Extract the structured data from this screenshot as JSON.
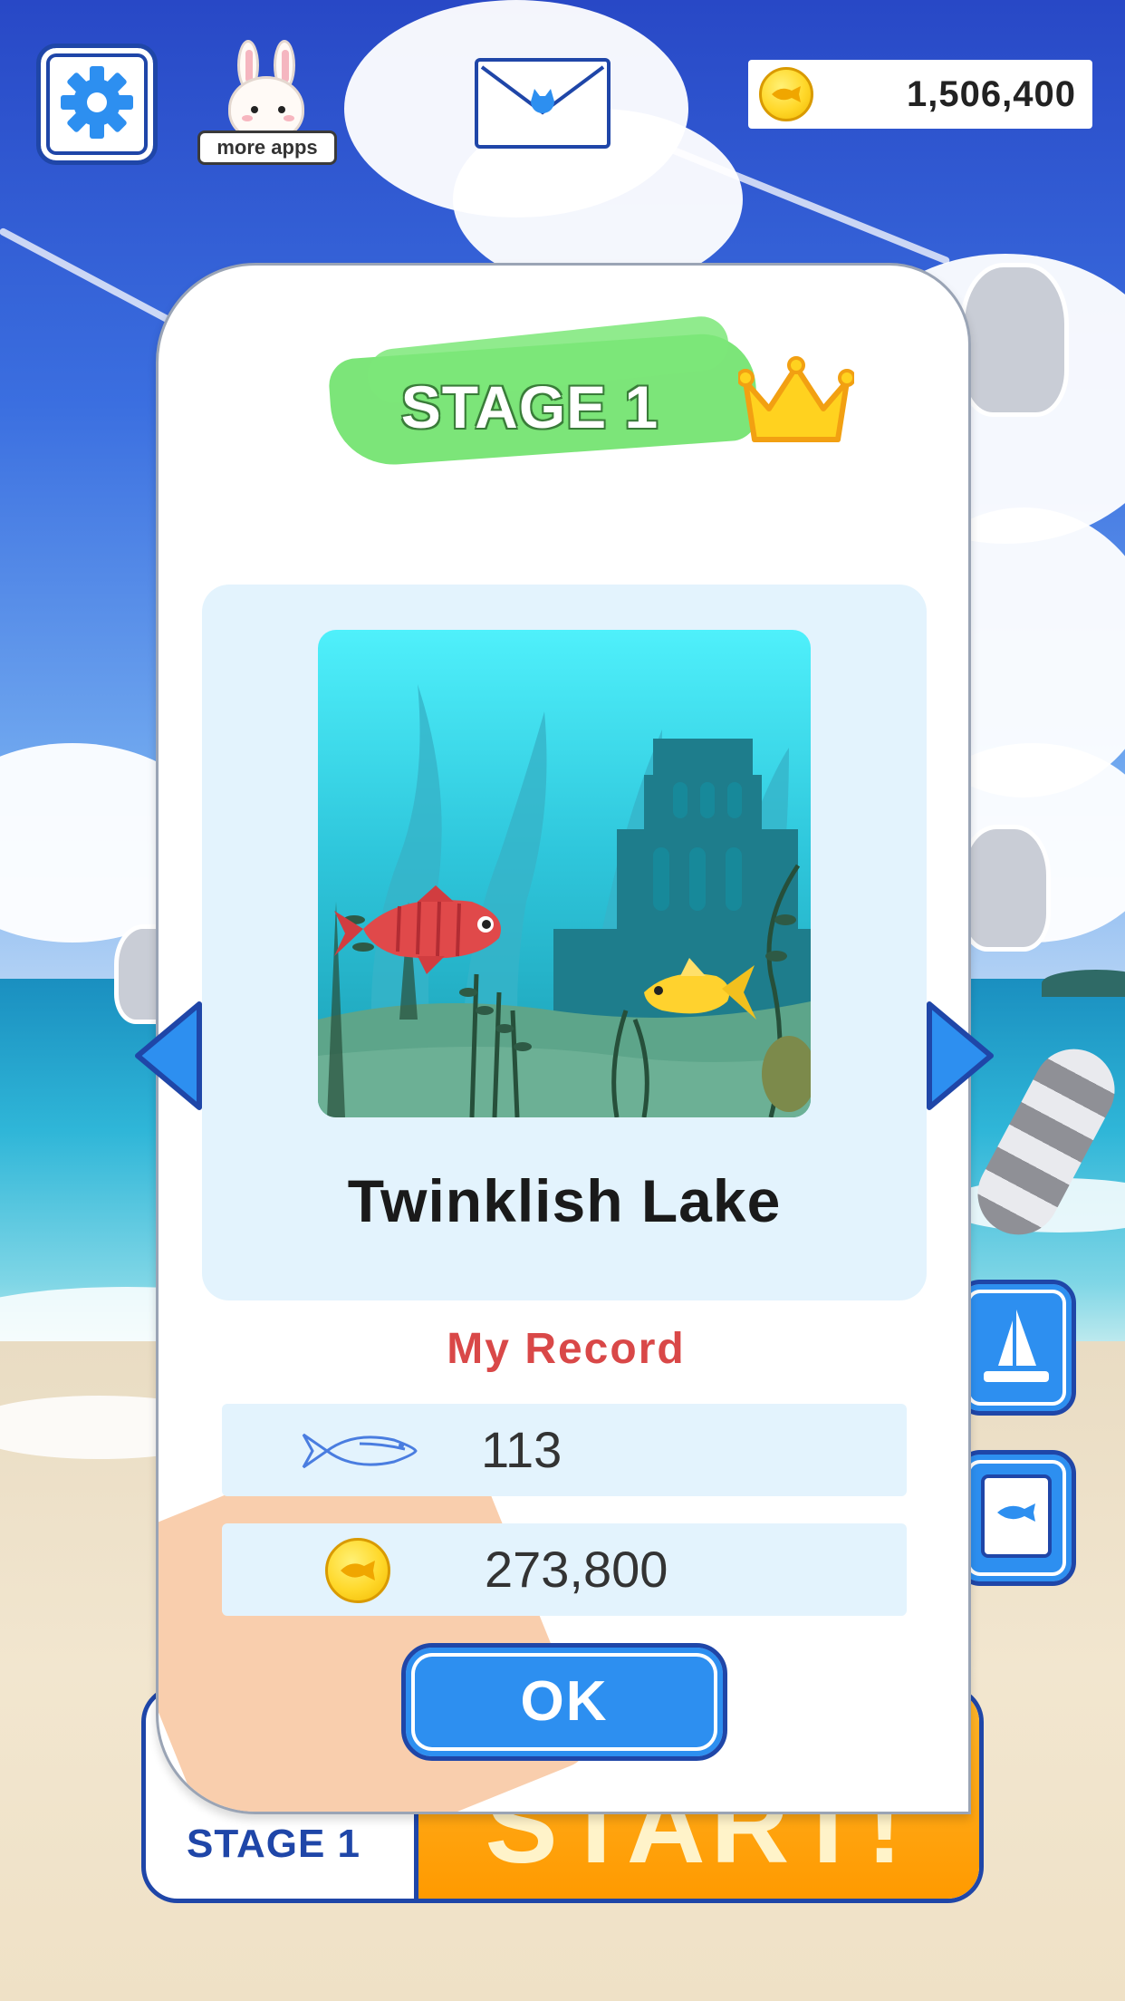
{
  "header": {
    "more_apps_label": "more apps",
    "coin_balance": "1,506,400"
  },
  "stage_panel": {
    "title": "STAGE 1",
    "stage_name": "Twinklish Lake",
    "record_title": "My Record",
    "records": [
      {
        "icon": "fish-outline-icon",
        "value": "113"
      },
      {
        "icon": "coin-icon",
        "value": "273,800"
      }
    ],
    "ok_label": "OK"
  },
  "bottom": {
    "stage_label": "STAGE 1",
    "start_label": "START!"
  },
  "colors": {
    "accent_blue": "#2d8ff0",
    "border_navy": "#1f46a8",
    "record_red": "#d94848",
    "start_orange": "#ff9a00",
    "title_green": "#6ee26a"
  }
}
